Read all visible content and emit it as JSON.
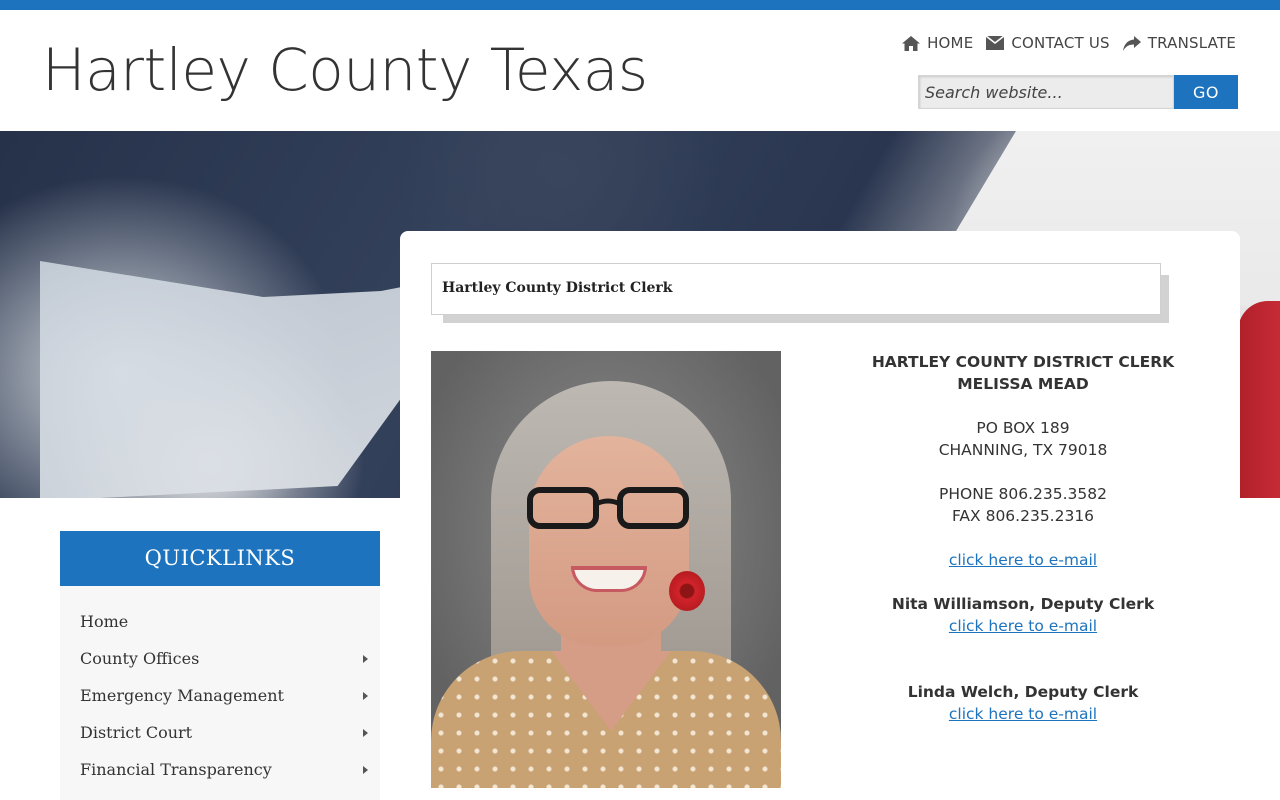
{
  "colors": {
    "accent": "#1e73be",
    "link": "#1e73be",
    "text": "#333333"
  },
  "header": {
    "site_title": "Hartley County Texas",
    "nav": [
      {
        "label": "HOME",
        "icon": "home-icon"
      },
      {
        "label": "CONTACT US",
        "icon": "envelope-icon"
      },
      {
        "label": "TRANSLATE",
        "icon": "share-arrow-icon"
      }
    ],
    "search": {
      "placeholder": "Search website...",
      "button_label": "GO"
    }
  },
  "main": {
    "page_heading": "Hartley County District Clerk",
    "contact": {
      "title": "HARTLEY COUNTY DISTRICT CLERK",
      "name": "MELISSA MEAD",
      "address_line1": "PO BOX 189",
      "address_line2": "CHANNING, TX 79018",
      "phone": "PHONE 806.235.3582",
      "fax": "FAX 806.235.2316",
      "email_link": "click here to e-mail",
      "deputies": [
        {
          "name": "Nita Williamson, Deputy Clerk",
          "email_link": "click here to e-mail"
        },
        {
          "name": "Linda Welch, Deputy Clerk",
          "email_link": "click here to e-mail"
        }
      ]
    }
  },
  "sidebar": {
    "quicklinks_title": "QUICKLINKS",
    "items": [
      {
        "label": "Home",
        "has_submenu": false
      },
      {
        "label": "County Offices",
        "has_submenu": true
      },
      {
        "label": "Emergency Management",
        "has_submenu": true
      },
      {
        "label": "District Court",
        "has_submenu": true
      },
      {
        "label": "Financial Transparency",
        "has_submenu": true
      }
    ]
  }
}
